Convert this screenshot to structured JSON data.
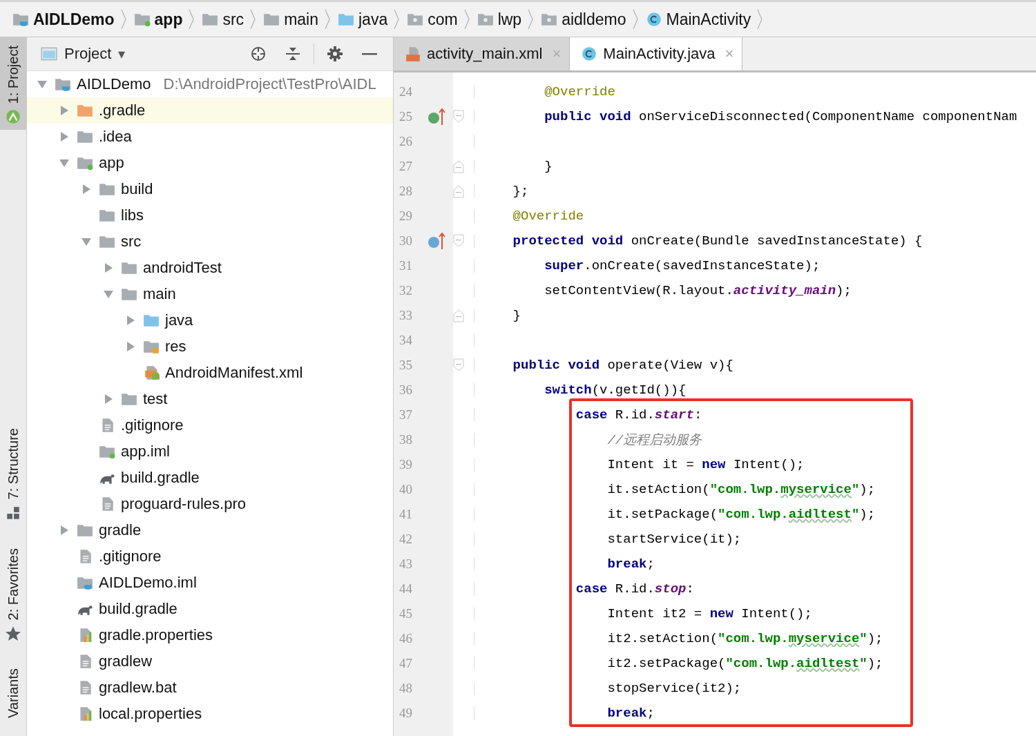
{
  "breadcrumbs": [
    {
      "label": "AIDLDemo",
      "kind": "project",
      "bold": true
    },
    {
      "label": "app",
      "kind": "module",
      "bold": true
    },
    {
      "label": "src",
      "kind": "folder",
      "bold": false
    },
    {
      "label": "main",
      "kind": "folder",
      "bold": false
    },
    {
      "label": "java",
      "kind": "source-folder",
      "bold": false
    },
    {
      "label": "com",
      "kind": "package",
      "bold": false
    },
    {
      "label": "lwp",
      "kind": "package",
      "bold": false
    },
    {
      "label": "aidldemo",
      "kind": "package",
      "bold": false
    },
    {
      "label": "MainActivity",
      "kind": "class",
      "bold": false
    }
  ],
  "tool_strip": [
    {
      "label": "1: Project",
      "kind": "android",
      "selected": true
    },
    {
      "label": "7: Structure",
      "kind": "structure",
      "selected": false
    },
    {
      "label": "2: Favorites",
      "kind": "star",
      "selected": false
    },
    {
      "label": "Variants",
      "selected": false
    }
  ],
  "project_panel": {
    "title": "Project",
    "caret": "▾"
  },
  "tree": [
    {
      "label": "AIDLDemo",
      "path": "D:\\AndroidProject\\TestPro\\AIDL",
      "kind": "project",
      "expanded": true,
      "selected": false,
      "children": [
        {
          "label": ".gradle",
          "kind": "excluded-folder",
          "expanded": false,
          "selected": true
        },
        {
          "label": ".idea",
          "kind": "folder",
          "expanded": false,
          "selected": false
        },
        {
          "label": "app",
          "kind": "module",
          "expanded": true,
          "selected": false,
          "children": [
            {
              "label": "build",
              "kind": "folder",
              "expanded": false,
              "selected": false
            },
            {
              "label": "libs",
              "kind": "folder",
              "selected": false
            },
            {
              "label": "src",
              "kind": "folder",
              "expanded": true,
              "selected": false,
              "children": [
                {
                  "label": "androidTest",
                  "kind": "folder",
                  "expanded": false,
                  "selected": false
                },
                {
                  "label": "main",
                  "kind": "folder",
                  "expanded": true,
                  "selected": false,
                  "children": [
                    {
                      "label": "java",
                      "kind": "source-folder",
                      "expanded": false,
                      "selected": false
                    },
                    {
                      "label": "res",
                      "kind": "resources",
                      "expanded": false,
                      "selected": false
                    },
                    {
                      "label": "AndroidManifest.xml",
                      "kind": "manifest",
                      "selected": false
                    }
                  ]
                },
                {
                  "label": "test",
                  "kind": "folder",
                  "expanded": false,
                  "selected": false
                }
              ]
            },
            {
              "label": ".gitignore",
              "kind": "file",
              "selected": false
            },
            {
              "label": "app.iml",
              "kind": "module",
              "selected": false
            },
            {
              "label": "build.gradle",
              "kind": "gradle",
              "selected": false
            },
            {
              "label": "proguard-rules.pro",
              "kind": "file",
              "selected": false
            }
          ]
        },
        {
          "label": "gradle",
          "kind": "folder",
          "expanded": false,
          "selected": false
        },
        {
          "label": ".gitignore",
          "kind": "file",
          "selected": false
        },
        {
          "label": "AIDLDemo.iml",
          "kind": "project",
          "selected": false
        },
        {
          "label": "build.gradle",
          "kind": "gradle",
          "selected": false
        },
        {
          "label": "gradle.properties",
          "kind": "properties",
          "selected": false
        },
        {
          "label": "gradlew",
          "kind": "file",
          "selected": false
        },
        {
          "label": "gradlew.bat",
          "kind": "file",
          "selected": false
        },
        {
          "label": "local.properties",
          "kind": "properties",
          "selected": false
        }
      ]
    }
  ],
  "editor_tabs": [
    {
      "label": "activity_main.xml",
      "kind": "xml",
      "close": "×",
      "selected": false
    },
    {
      "label": "MainActivity.java",
      "kind": "class",
      "close": "×",
      "selected": true
    }
  ],
  "code": [
    {
      "n": "24",
      "boxed": false,
      "tokens": [
        {
          "text": "        @Override",
          "kind": "annotation"
        }
      ]
    },
    {
      "n": "25",
      "gutter": {
        "kind": "implements"
      },
      "fold": {
        "kind": "start"
      },
      "boxed": false,
      "tokens": [
        {
          "text": "        public void",
          "kind": "keyword"
        },
        {
          "text": " onServiceDisconnected(ComponentName componentNam",
          "kind": "plain"
        }
      ]
    },
    {
      "n": "26",
      "boxed": false
    },
    {
      "n": "27",
      "fold": {
        "kind": "end"
      },
      "boxed": false,
      "tokens": [
        {
          "text": "        }",
          "kind": "plain"
        }
      ]
    },
    {
      "n": "28",
      "fold": {
        "kind": "end"
      },
      "boxed": false,
      "tokens": [
        {
          "text": "    };",
          "kind": "plain"
        }
      ]
    },
    {
      "n": "29",
      "boxed": false,
      "tokens": [
        {
          "text": "    @Override",
          "kind": "annotation"
        }
      ]
    },
    {
      "n": "30",
      "gutter": {
        "kind": "overrides"
      },
      "fold": {
        "kind": "start"
      },
      "boxed": false,
      "tokens": [
        {
          "text": "    protected void",
          "kind": "keyword"
        },
        {
          "text": " onCreate(Bundle savedInstanceState) {",
          "kind": "plain"
        }
      ]
    },
    {
      "n": "31",
      "boxed": false,
      "tokens": [
        {
          "text": "        super",
          "kind": "keyword"
        },
        {
          "text": ".onCreate(savedInstanceState);",
          "kind": "plain"
        }
      ]
    },
    {
      "n": "32",
      "boxed": false,
      "tokens": [
        {
          "text": "        setContentView(R.layout.",
          "kind": "plain"
        },
        {
          "text": "activity_main",
          "kind": "field"
        },
        {
          "text": ");",
          "kind": "plain"
        }
      ]
    },
    {
      "n": "33",
      "fold": {
        "kind": "end"
      },
      "boxed": false,
      "tokens": [
        {
          "text": "    }",
          "kind": "plain"
        }
      ]
    },
    {
      "n": "34",
      "boxed": false
    },
    {
      "n": "35",
      "fold": {
        "kind": "start"
      },
      "boxed": false,
      "tokens": [
        {
          "text": "    public void",
          "kind": "keyword"
        },
        {
          "text": " operate(View v){",
          "kind": "plain"
        }
      ]
    },
    {
      "n": "36",
      "boxed": false,
      "tokens": [
        {
          "text": "        switch",
          "kind": "keyword"
        },
        {
          "text": "(v.getId()){",
          "kind": "plain"
        }
      ]
    },
    {
      "n": "37",
      "boxed": true,
      "tokens": [
        {
          "text": "            case",
          "kind": "keyword"
        },
        {
          "text": " R.id.",
          "kind": "plain"
        },
        {
          "text": "start",
          "kind": "field"
        },
        {
          "text": ":",
          "kind": "plain"
        }
      ]
    },
    {
      "n": "38",
      "boxed": true,
      "tokens": [
        {
          "text": "                //远程启动服务",
          "kind": "comment"
        }
      ]
    },
    {
      "n": "39",
      "boxed": true,
      "tokens": [
        {
          "text": "                Intent it = ",
          "kind": "plain"
        },
        {
          "text": "new",
          "kind": "keyword"
        },
        {
          "text": " Intent();",
          "kind": "plain"
        }
      ]
    },
    {
      "n": "40",
      "boxed": true,
      "tokens": [
        {
          "text": "                it.setAction(",
          "kind": "plain"
        },
        {
          "text": "\"com.lwp.",
          "kind": "string"
        },
        {
          "text": "myservice",
          "kind": "misspelled"
        },
        {
          "text": "\"",
          "kind": "string"
        },
        {
          "text": ");",
          "kind": "plain"
        }
      ]
    },
    {
      "n": "41",
      "boxed": true,
      "tokens": [
        {
          "text": "                it.setPackage(",
          "kind": "plain"
        },
        {
          "text": "\"com.lwp.",
          "kind": "string"
        },
        {
          "text": "aidltest",
          "kind": "misspelled"
        },
        {
          "text": "\"",
          "kind": "string"
        },
        {
          "text": ");",
          "kind": "plain"
        }
      ]
    },
    {
      "n": "42",
      "boxed": true,
      "tokens": [
        {
          "text": "                startService(it);",
          "kind": "plain"
        }
      ]
    },
    {
      "n": "43",
      "boxed": true,
      "tokens": [
        {
          "text": "                break",
          "kind": "keyword"
        },
        {
          "text": ";",
          "kind": "plain"
        }
      ]
    },
    {
      "n": "44",
      "boxed": true,
      "tokens": [
        {
          "text": "            case",
          "kind": "keyword"
        },
        {
          "text": " R.id.",
          "kind": "plain"
        },
        {
          "text": "stop",
          "kind": "field"
        },
        {
          "text": ":",
          "kind": "plain"
        }
      ]
    },
    {
      "n": "45",
      "boxed": true,
      "tokens": [
        {
          "text": "                Intent it2 = ",
          "kind": "plain"
        },
        {
          "text": "new",
          "kind": "keyword"
        },
        {
          "text": " Intent();",
          "kind": "plain"
        }
      ]
    },
    {
      "n": "46",
      "boxed": true,
      "tokens": [
        {
          "text": "                it2.setAction(",
          "kind": "plain"
        },
        {
          "text": "\"com.lwp.",
          "kind": "string"
        },
        {
          "text": "myservice",
          "kind": "misspelled"
        },
        {
          "text": "\"",
          "kind": "string"
        },
        {
          "text": ");",
          "kind": "plain"
        }
      ]
    },
    {
      "n": "47",
      "boxed": true,
      "tokens": [
        {
          "text": "                it2.setPackage(",
          "kind": "plain"
        },
        {
          "text": "\"com.lwp.",
          "kind": "string"
        },
        {
          "text": "aidltest",
          "kind": "misspelled"
        },
        {
          "text": "\"",
          "kind": "string"
        },
        {
          "text": ");",
          "kind": "plain"
        }
      ]
    },
    {
      "n": "48",
      "boxed": true,
      "tokens": [
        {
          "text": "                stopService(it2);",
          "kind": "plain"
        }
      ]
    },
    {
      "n": "49",
      "boxed": true,
      "tokens": [
        {
          "text": "                break",
          "kind": "keyword"
        },
        {
          "text": ";",
          "kind": "plain"
        }
      ]
    }
  ]
}
